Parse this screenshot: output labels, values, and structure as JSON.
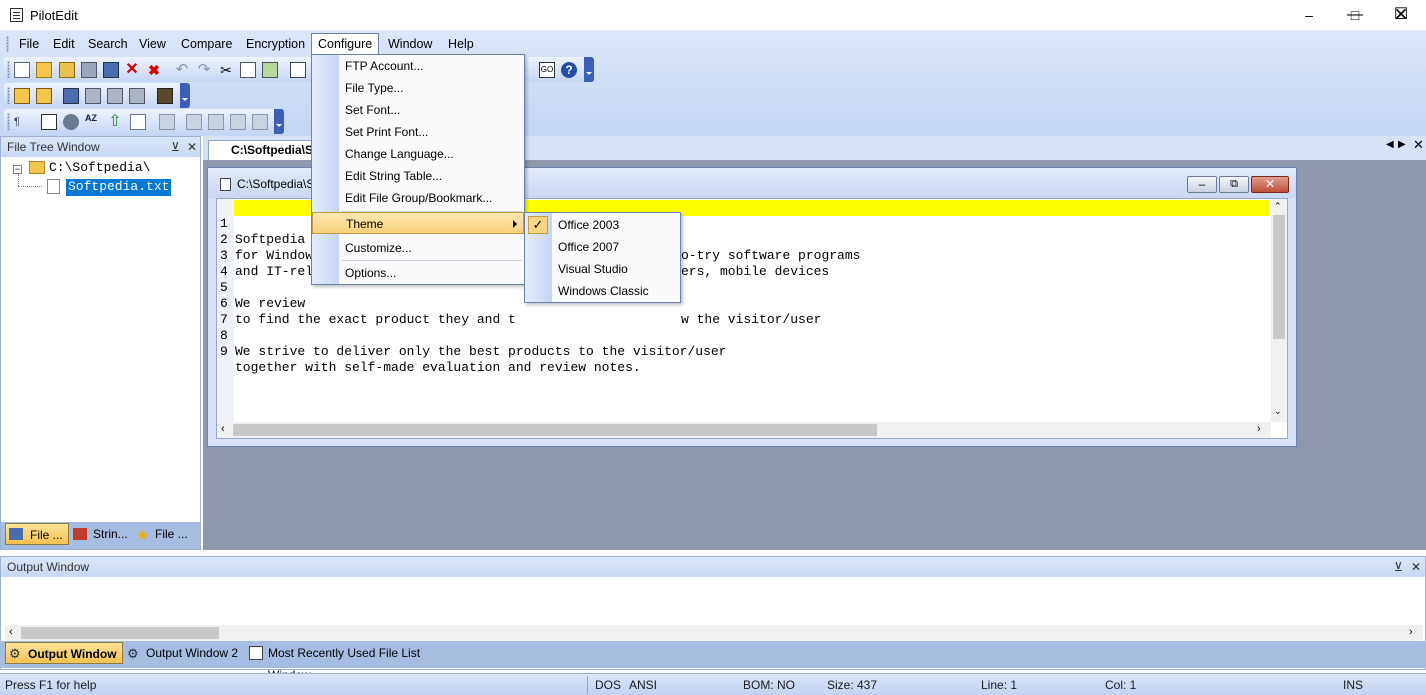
{
  "app": {
    "title": "PilotEdit"
  },
  "menubar": {
    "items": [
      "File",
      "Edit",
      "Search",
      "View",
      "Compare",
      "Encryption",
      "Configure",
      "Window",
      "Help"
    ]
  },
  "configure_menu": {
    "items": [
      {
        "label": "FTP Account...",
        "accel": "F"
      },
      {
        "label": "File Type...",
        "accel": "T"
      },
      {
        "label": "Set Font...",
        "accel": "S"
      },
      {
        "label": "Set Print Font...",
        "accel": ""
      },
      {
        "label": "Change Language...",
        "accel": "L"
      },
      {
        "label": "Edit String Table...",
        "accel": "E"
      },
      {
        "label": "Edit File Group/Bookmark...",
        "accel": ""
      },
      {
        "label": "Theme",
        "accel": "h"
      },
      {
        "label": "Customize...",
        "accel": "C"
      },
      {
        "label": "Options...",
        "accel": "O"
      }
    ]
  },
  "theme_menu": {
    "items": [
      "Office 2003",
      "Office 2007",
      "Visual Studio",
      "Windows Classic"
    ],
    "checked": "Office 2003"
  },
  "file_tree": {
    "title": "File Tree Window",
    "root": "C:\\Softpedia\\",
    "file": "Softpedia.txt",
    "tabs": [
      "File ...",
      "Strin...",
      "File ..."
    ]
  },
  "document": {
    "tab_label": "C:\\Softpedia\\S",
    "window_title": "C:\\Softpedia\\S",
    "lines": [
      {
        "n": "1",
        "text": "Softpedia is a library of over 1,300,000 free and free-to-try software programs"
      },
      {
        "n": "2",
        "text": "for Windows and Unix/Linux, games, Mac software, Windows drivers, mobile devices"
      },
      {
        "n": "3",
        "text": "and IT-related articles."
      },
      {
        "n": "4",
        "text": ""
      },
      {
        "n": "5",
        "text": "We review and categorize these products in order to allow the visitor/user"
      },
      {
        "n": "6",
        "text": "to find the exact product they and their system needs."
      },
      {
        "n": "7",
        "text": ""
      },
      {
        "n": "8",
        "text": "We strive to deliver only the best products to the visitor/user"
      },
      {
        "n": "9",
        "text": "together with self-made evaluation and review notes."
      }
    ],
    "visible": {
      "l1_a": "Softpedia",
      "l1_b": ",000 free and free-to-try software programs",
      "l2_a": "for Window",
      "l2_b": "ers, mobile devices",
      "l3_a": "and IT-rel",
      "l5_a": "We review",
      "l5_b": "w the visitor/user",
      "l6_a": "to find the exact product they and t",
      "l8": "We strive to deliver only the best products to the visitor/user",
      "l9": "together with self-made evaluation and review notes."
    }
  },
  "output": {
    "title": "Output Window",
    "tabs": [
      "Output Window",
      "Output Window 2",
      "Most Recently Used File List Window"
    ]
  },
  "status": {
    "help": "Press F1 for help",
    "eol": "DOS",
    "encoding": "ANSI",
    "bom": "BOM: NO",
    "size": "Size: 437",
    "line": "Line: 1",
    "col": "Col: 1",
    "mode": "INS"
  },
  "colors": {
    "accent": "#3a5fb8",
    "highlight": "#ffff00",
    "selection": "#0078d7"
  }
}
